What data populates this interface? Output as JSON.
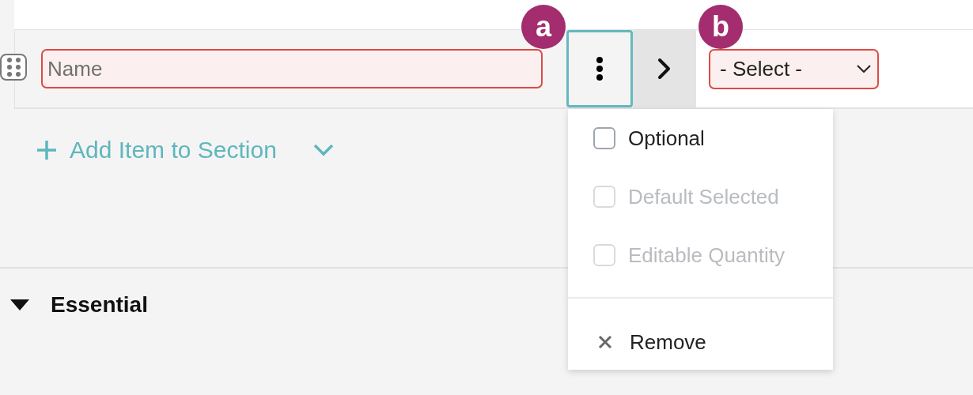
{
  "item": {
    "name_placeholder": "Name",
    "name_error": true,
    "menu_open": true,
    "select": {
      "value": "- Select -",
      "error": true
    }
  },
  "badges": [
    {
      "label": "a"
    },
    {
      "label": "b"
    }
  ],
  "add_item": {
    "label": "Add Item to Section"
  },
  "menu": {
    "options": [
      {
        "label": "Optional",
        "checked": false,
        "disabled": false
      },
      {
        "label": "Default Selected",
        "checked": false,
        "disabled": true
      },
      {
        "label": "Editable Quantity",
        "checked": false,
        "disabled": true
      }
    ],
    "actions": [
      {
        "label": "Remove"
      }
    ]
  },
  "section": {
    "title": "Essential",
    "expanded": true
  }
}
